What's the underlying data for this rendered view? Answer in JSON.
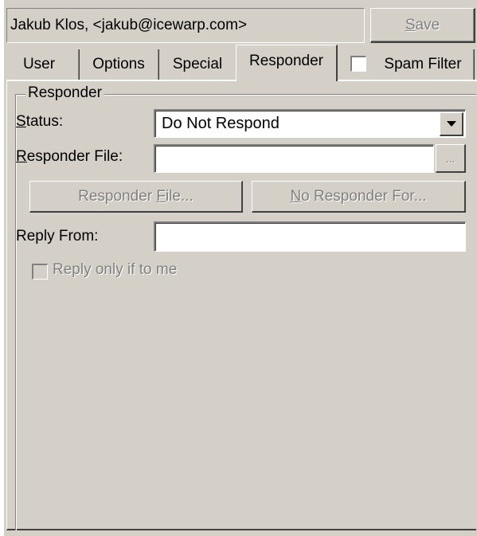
{
  "header": {
    "account": "Jakub Klos, <jakub@icewarp.com>",
    "save_label": "Save",
    "save_mnemonic": "S",
    "save_rest": "ave"
  },
  "tabs": [
    {
      "label": "User"
    },
    {
      "label": "Options"
    },
    {
      "label": "Special"
    },
    {
      "label": "Responder"
    },
    {
      "label": "Spam Filter"
    }
  ],
  "responder": {
    "group_title": "Responder",
    "status_label_mnemonic": "S",
    "status_label_rest": "tatus:",
    "status_value": "Do Not Respond",
    "file_label_mnemonic": "R",
    "file_label_rest": "esponder File:",
    "file_value": "",
    "browse_label": "...",
    "responder_file_btn_pre": "Responder ",
    "responder_file_btn_mnemonic": "F",
    "responder_file_btn_post": "ile...",
    "no_responder_btn_mnemonic": "N",
    "no_responder_btn_post": "o Responder For...",
    "reply_from_label": "Reply From:",
    "reply_from_value": "",
    "reply_only_label": "Reply only if to me"
  }
}
